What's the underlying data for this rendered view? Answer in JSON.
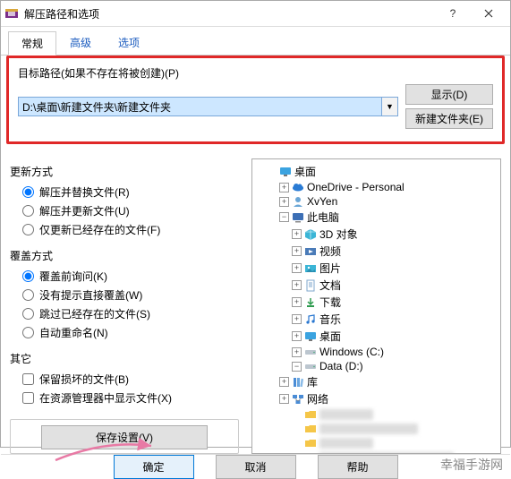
{
  "titlebar": {
    "title": "解压路径和选项"
  },
  "tabs": {
    "general": "常规",
    "advanced": "高级",
    "options": "选项"
  },
  "path": {
    "label": "目标路径(如果不存在将被创建)(P)",
    "value": "D:\\桌面\\新建文件夹\\新建文件夹",
    "display_btn": "显示(D)",
    "newfolder_btn": "新建文件夹(E)"
  },
  "update_mode": {
    "title": "更新方式",
    "opt1": "解压并替换文件(R)",
    "opt2": "解压并更新文件(U)",
    "opt3": "仅更新已经存在的文件(F)"
  },
  "overwrite_mode": {
    "title": "覆盖方式",
    "opt1": "覆盖前询问(K)",
    "opt2": "没有提示直接覆盖(W)",
    "opt3": "跳过已经存在的文件(S)",
    "opt4": "自动重命名(N)"
  },
  "misc": {
    "title": "其它",
    "opt1": "保留损坏的文件(B)",
    "opt2": "在资源管理器中显示文件(X)"
  },
  "save_btn": "保存设置(V)",
  "tree": {
    "desktop": "桌面",
    "onedrive": "OneDrive - Personal",
    "xvyen": "XvYen",
    "thispc": "此电脑",
    "obj3d": "3D 对象",
    "video": "视频",
    "pic": "图片",
    "doc": "文档",
    "download": "下载",
    "music": "音乐",
    "desktop2": "桌面",
    "windows_c": "Windows (C:)",
    "data_d": "Data (D:)",
    "libraries": "库",
    "network": "网络"
  },
  "footer": {
    "ok": "确定",
    "cancel": "取消",
    "help": "帮助"
  },
  "watermark": "幸福手游网"
}
